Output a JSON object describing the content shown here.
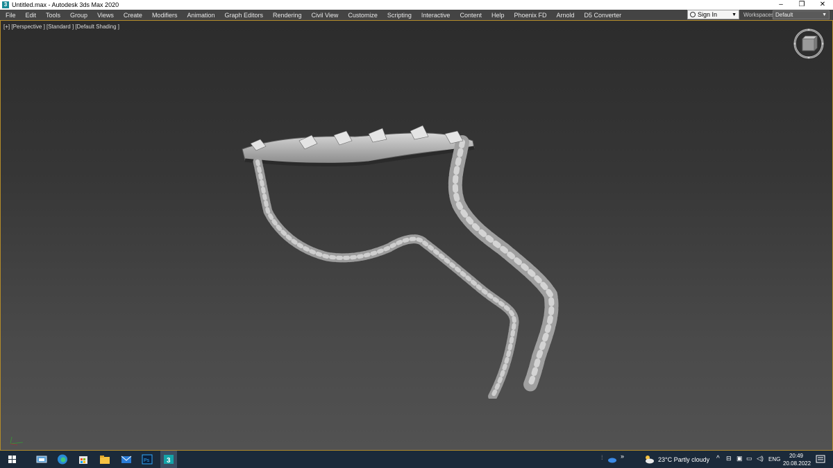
{
  "window": {
    "title": "Untitled.max - Autodesk 3ds Max 2020",
    "app_icon_glyph": "3"
  },
  "window_controls": {
    "minimize": "–",
    "maximize": "❐",
    "close": "✕"
  },
  "menu": [
    "File",
    "Edit",
    "Tools",
    "Group",
    "Views",
    "Create",
    "Modifiers",
    "Animation",
    "Graph Editors",
    "Rendering",
    "Civil View",
    "Customize",
    "Scripting",
    "Interactive",
    "Content",
    "Help",
    "Phoenix FD",
    "Arnold",
    "D5 Converter"
  ],
  "signin": {
    "label": "Sign In"
  },
  "workspace": {
    "label": "Workspaces:",
    "value": "Default"
  },
  "viewport": {
    "label": "[+] [Perspective ] [Standard ] [Default Shading ]",
    "border_color": "#b38b2a"
  },
  "taskbar": {
    "weather": "23°C  Partly cloudy",
    "language": "ENG",
    "time": "20:49",
    "date": "20.08.2022",
    "active_app": "3ds-max"
  }
}
